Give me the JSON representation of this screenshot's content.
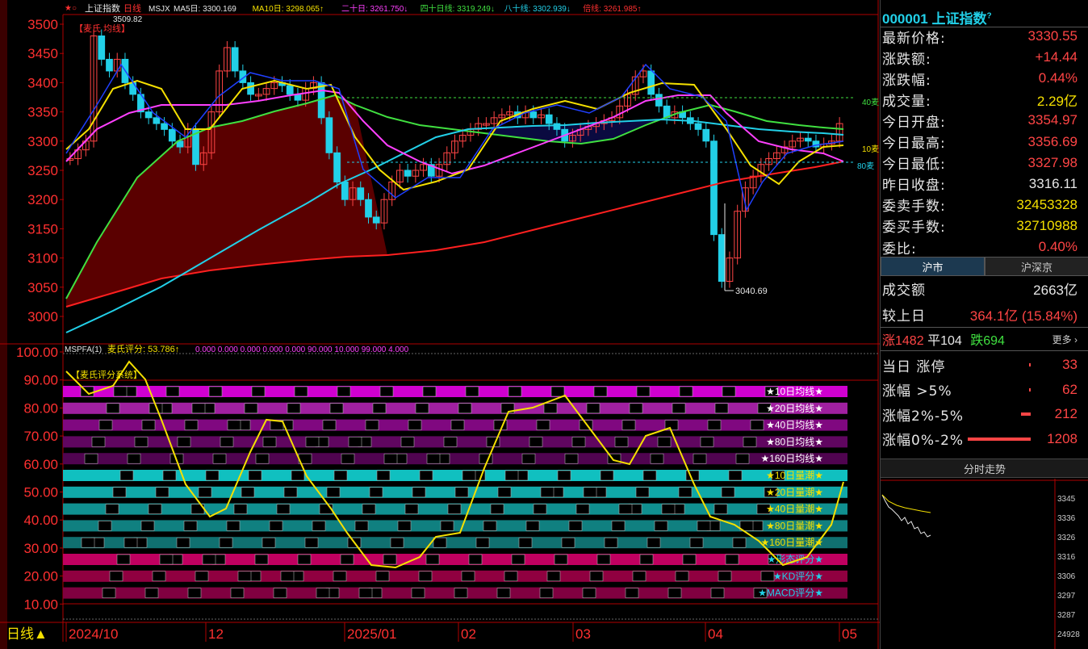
{
  "header": {
    "code": "000001",
    "name": "上证指数",
    "period": "日线",
    "indicator_name": "MSJX",
    "ma_items": [
      {
        "label": "MA5日: 3300.169",
        "color": "#e6e6e6"
      },
      {
        "label": "MA10日: 3298.065↑",
        "color": "#f5e000"
      },
      {
        "label": "二十日: 3261.750↓",
        "color": "#ff40ff"
      },
      {
        "label": "四十日线: 3319.249↓",
        "color": "#40e040"
      },
      {
        "label": "八十线: 3302.939↓",
        "color": "#22d0e8"
      },
      {
        "label": "倍线: 3261.985↑",
        "color": "#ff3030"
      }
    ],
    "hi_note": "3509.82"
  },
  "main_chart": {
    "title_tag": "【麦氏 均线】",
    "price_ticks": [
      "3500",
      "3450",
      "3400",
      "3350",
      "3300",
      "3250",
      "3200",
      "3150",
      "3100",
      "3050",
      "3000"
    ],
    "low_label": "3040.69",
    "right_labels": [
      "40麦",
      "10麦",
      "80麦"
    ]
  },
  "sub_chart": {
    "formula": "MSPFA(1)",
    "score_label": "麦氏评分: 53.786↑",
    "params": "0.000 0.000 0.000 0.000 0.000 90.000 10.000 99.000 4.000",
    "system_tag": "【麦氏评分系统】",
    "y_ticks": [
      "100.00",
      "90.00",
      "80.00",
      "70.00",
      "60.00",
      "50.00",
      "40.00",
      "30.00",
      "20.00",
      "10.00"
    ],
    "bands": [
      {
        "label": "★10日均线★",
        "color": "#d000d0",
        "lcolor": "#fff"
      },
      {
        "label": "★20日均线★",
        "color": "#a020a0",
        "lcolor": "#fff"
      },
      {
        "label": "★40日均线★",
        "color": "#800880",
        "lcolor": "#fff"
      },
      {
        "label": "★80日均线★",
        "color": "#600660",
        "lcolor": "#fff"
      },
      {
        "label": "★160日均线★",
        "color": "#500450",
        "lcolor": "#fff"
      },
      {
        "label": "★10日量潮★",
        "color": "#10c0c0",
        "lcolor": "#f5e000"
      },
      {
        "label": "★20日量潮★",
        "color": "#10a8a8",
        "lcolor": "#f5e000"
      },
      {
        "label": "★40日量潮★",
        "color": "#109090",
        "lcolor": "#f5e000"
      },
      {
        "label": "★80日量潮★",
        "color": "#108080",
        "lcolor": "#f5e000"
      },
      {
        "label": "★160日量潮★",
        "color": "#107070",
        "lcolor": "#f5e000"
      },
      {
        "label": "★形态评分★",
        "color": "#c00060",
        "lcolor": "#22d0e8"
      },
      {
        "label": "★KD评分★",
        "color": "#900040",
        "lcolor": "#22d0e8"
      },
      {
        "label": "★MACD评分★",
        "color": "#800040",
        "lcolor": "#22d0e8"
      }
    ]
  },
  "x_axis": {
    "period_label": "日线▲",
    "dates": [
      "2024/10",
      "12",
      "2025/01",
      "02",
      "03",
      "04",
      "05"
    ]
  },
  "panel": {
    "quote_rows": [
      {
        "k": "最新价格:",
        "v": "3330.55",
        "c": "red"
      },
      {
        "k": "涨跌额:",
        "v": "+14.44",
        "c": "red"
      },
      {
        "k": "涨跌幅:",
        "v": "0.44%",
        "c": "red"
      },
      {
        "k": "成交量:",
        "v": "2.29亿",
        "c": "yel"
      },
      {
        "k": "今日开盘:",
        "v": "3354.97",
        "c": "red"
      },
      {
        "k": "今日最高:",
        "v": "3356.69",
        "c": "red"
      },
      {
        "k": "今日最低:",
        "v": "3327.98",
        "c": "red"
      },
      {
        "k": "昨日收盘:",
        "v": "3316.11",
        "c": "wht"
      },
      {
        "k": "委卖手数:",
        "v": "32453328",
        "c": "yel"
      },
      {
        "k": "委买手数:",
        "v": "32710988",
        "c": "yel"
      },
      {
        "k": "委比:",
        "v": "0.40%",
        "c": "red"
      }
    ],
    "tabs": [
      "沪市",
      "沪深京"
    ],
    "turnover_label": "成交额",
    "turnover_value": "2663亿",
    "compare_label": "较上日",
    "compare_value": "364.1亿 (15.84%)",
    "up_label": "涨1482",
    "flat_label": "平104",
    "down_label": "跌694",
    "more_label": "更多",
    "dist_rows": [
      {
        "k": "当日 涨停",
        "v": "33",
        "w": 2
      },
      {
        "k": "涨幅 >5%",
        "v": "62",
        "w": 2
      },
      {
        "k": "涨幅2%-5%",
        "v": "212",
        "w": 12
      },
      {
        "k": "涨幅0%-2%",
        "v": "1208",
        "w": 78
      }
    ],
    "fenshi_label": "分时走势",
    "mini_ticks": [
      "3345",
      "3336",
      "3326",
      "3316",
      "3306",
      "3297",
      "3287",
      "24928"
    ]
  }
}
